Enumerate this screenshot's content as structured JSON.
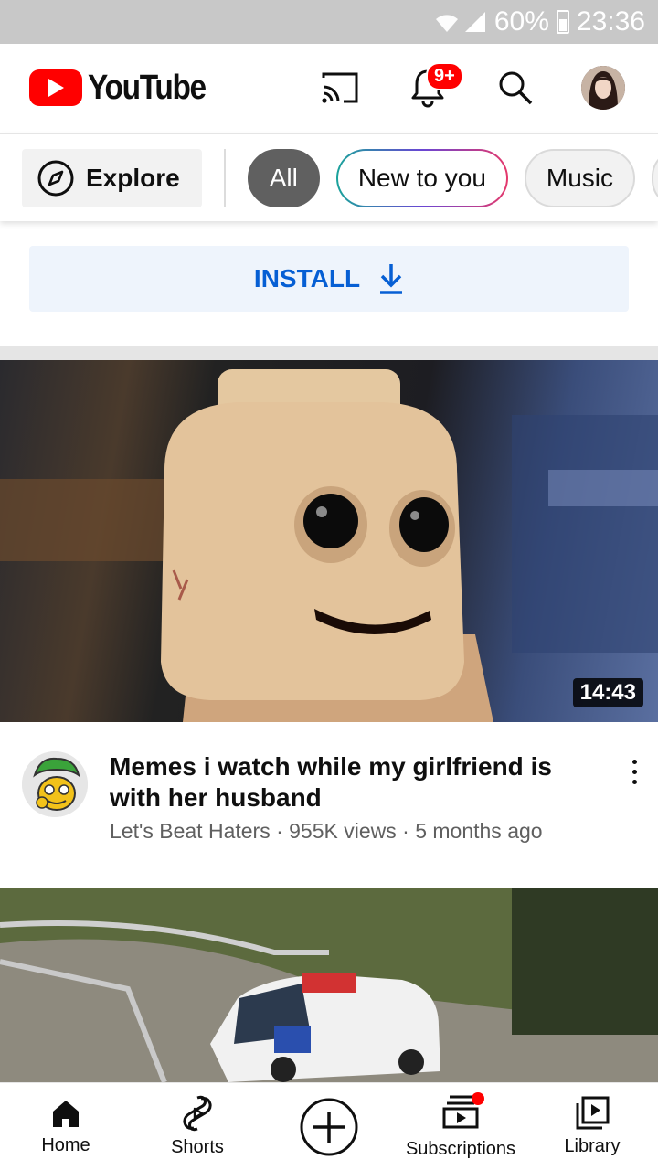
{
  "status_bar": {
    "battery": "60%",
    "time": "23:36"
  },
  "app": {
    "name": "YouTube",
    "notifications_badge": "9+"
  },
  "icons": {
    "cast": "cast-icon",
    "notifications": "bell-icon",
    "search": "search-icon",
    "account": "account-avatar",
    "explore": "compass-icon",
    "install": "download-icon",
    "more": "more-vert-icon",
    "home": "home-icon",
    "shorts": "shorts-icon",
    "create": "add-circle-icon",
    "subscriptions": "subscriptions-icon",
    "library": "library-icon"
  },
  "chips": {
    "explore_label": "Explore",
    "items": [
      {
        "label": "All",
        "active": true
      },
      {
        "label": "New to you",
        "active": false
      },
      {
        "label": "Music",
        "active": false
      }
    ]
  },
  "install": {
    "label": "INSTALL"
  },
  "feed": {
    "videos": [
      {
        "duration": "14:43",
        "title": "Memes i watch while my girlfriend is with her husband",
        "channel": "Let's Beat Haters",
        "views": "955K views",
        "age": "5 months ago",
        "subtitle": "Let's Beat Haters · 955K views · 5 months ago"
      }
    ]
  },
  "bottom_nav": {
    "home": "Home",
    "shorts": "Shorts",
    "subscriptions": "Subscriptions",
    "library": "Library"
  },
  "colors": {
    "brand_red": "#ff0000",
    "install_blue": "#065fd4",
    "chip_active": "#606060"
  }
}
